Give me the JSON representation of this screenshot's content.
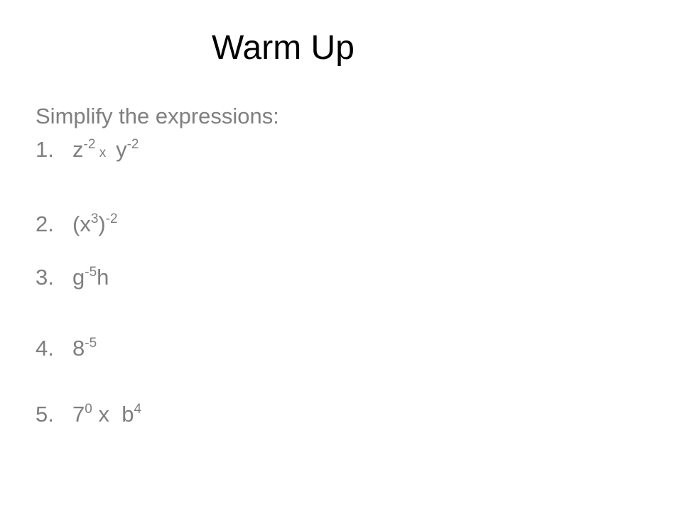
{
  "slide": {
    "title": "Warm Up",
    "instruction": "Simplify the expressions:",
    "items": [
      {
        "number": "1.",
        "parts": {
          "base1": "z",
          "exp1": "-2",
          "op": "x",
          "base2": "y",
          "exp2": "-2"
        }
      },
      {
        "number": "2.",
        "parts": {
          "open": "(x",
          "exp_inner": "3",
          "close": ")",
          "exp_outer": "-2"
        }
      },
      {
        "number": "3.",
        "parts": {
          "base1": "g",
          "exp1": "-5",
          "tail": "h"
        }
      },
      {
        "number": "4.",
        "parts": {
          "base1": "8",
          "exp1": "-5"
        }
      },
      {
        "number": "5.",
        "parts": {
          "base1": "7",
          "exp1": "0",
          "op": "x",
          "base2": "b",
          "exp2": "4"
        }
      }
    ]
  }
}
